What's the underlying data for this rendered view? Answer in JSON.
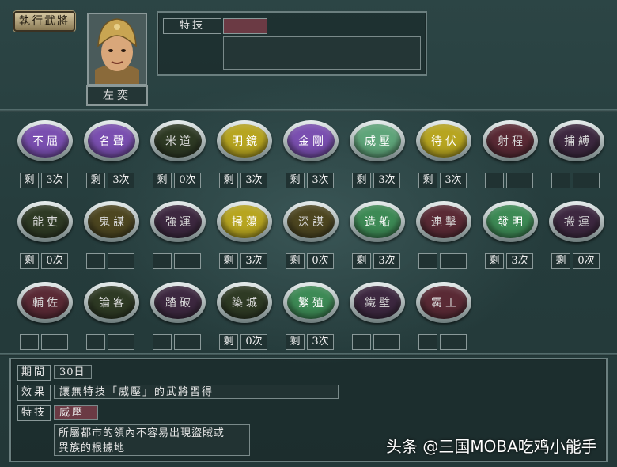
{
  "header": {
    "role_button": "執行武將",
    "officer_name": "左奕",
    "special_label": "特技",
    "special_value": ""
  },
  "skills": [
    {
      "name": "不屈",
      "color": "#7a4fb0",
      "remain": "剩",
      "count": "3次"
    },
    {
      "name": "名聲",
      "color": "#7a4fb0",
      "remain": "剩",
      "count": "3次"
    },
    {
      "name": "米道",
      "color": "#2e3a24",
      "remain": "剩",
      "count": "0次"
    },
    {
      "name": "明鏡",
      "color": "#b7a520",
      "remain": "剩",
      "count": "3次"
    },
    {
      "name": "金剛",
      "color": "#7a4fb0",
      "remain": "剩",
      "count": "3次"
    },
    {
      "name": "威壓",
      "color": "#5fa57a",
      "remain": "剩",
      "count": "3次"
    },
    {
      "name": "待伏",
      "color": "#b7a520",
      "remain": "剩",
      "count": "3次"
    },
    {
      "name": "射程",
      "color": "#5a2a35",
      "remain": "",
      "count": ""
    },
    {
      "name": "捕縛",
      "color": "#3d2840",
      "remain": "",
      "count": ""
    },
    {
      "name": "能吏",
      "color": "#2e3a24",
      "remain": "剩",
      "count": "0次"
    },
    {
      "name": "鬼謀",
      "color": "#4d4620",
      "remain": "",
      "count": ""
    },
    {
      "name": "強運",
      "color": "#3d2840",
      "remain": "",
      "count": ""
    },
    {
      "name": "掃蕩",
      "color": "#b7a520",
      "remain": "剩",
      "count": "3次"
    },
    {
      "name": "深謀",
      "color": "#4d4620",
      "remain": "剩",
      "count": "0次"
    },
    {
      "name": "造船",
      "color": "#3d8a55",
      "remain": "剩",
      "count": "3次"
    },
    {
      "name": "連擊",
      "color": "#5a2a35",
      "remain": "",
      "count": ""
    },
    {
      "name": "發明",
      "color": "#3d8a55",
      "remain": "剩",
      "count": "3次"
    },
    {
      "name": "搬運",
      "color": "#3d2840",
      "remain": "剩",
      "count": "0次"
    },
    {
      "name": "輔佐",
      "color": "#5a2a35",
      "remain": "",
      "count": ""
    },
    {
      "name": "論客",
      "color": "#2e3a24",
      "remain": "",
      "count": ""
    },
    {
      "name": "踏破",
      "color": "#3d2840",
      "remain": "",
      "count": ""
    },
    {
      "name": "築城",
      "color": "#2e3a24",
      "remain": "剩",
      "count": "0次"
    },
    {
      "name": "繁殖",
      "color": "#3d8a55",
      "remain": "剩",
      "count": "3次"
    },
    {
      "name": "鐵壁",
      "color": "#3d2840",
      "remain": "",
      "count": ""
    },
    {
      "name": "霸王",
      "color": "#5a2a35",
      "remain": "",
      "count": ""
    }
  ],
  "info": {
    "period_label": "期間",
    "period_value": "30日",
    "effect_label": "效果",
    "effect_value": "讓無特技「威壓」的武將習得",
    "skill_label": "特技",
    "skill_value": "威壓",
    "desc_line1": "所屬都市的領內不容易出現盜賊或",
    "desc_line2": "異族的根據地"
  },
  "watermark": "头条 @三国MOBA吃鸡小能手"
}
